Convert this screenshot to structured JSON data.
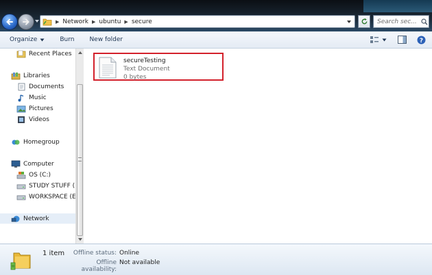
{
  "address": {
    "breadcrumbs": [
      "Network",
      "ubuntu",
      "secure"
    ]
  },
  "search": {
    "placeholder": "Search sec..."
  },
  "toolbar": {
    "organize_label": "Organize",
    "burn_label": "Burn",
    "new_folder_label": "New folder"
  },
  "nav": {
    "items": [
      {
        "label": "Recent Places"
      },
      {
        "label": "Libraries"
      },
      {
        "label": "Documents"
      },
      {
        "label": "Music"
      },
      {
        "label": "Pictures"
      },
      {
        "label": "Videos"
      },
      {
        "label": "Homegroup"
      },
      {
        "label": "Computer"
      },
      {
        "label": "OS (C:)"
      },
      {
        "label": "STUDY STUFF (D:"
      },
      {
        "label": "WORKSPACE (E:)"
      },
      {
        "label": "Network"
      }
    ]
  },
  "files": [
    {
      "name": "secureTesting",
      "type": "Text Document",
      "size": "0 bytes"
    }
  ],
  "status": {
    "item_count": "1 item",
    "offline_status_label": "Offline status:",
    "offline_status_value": "Online",
    "offline_availability_label": "Offline availability:",
    "offline_availability_value": "Not available"
  },
  "colors": {
    "highlight_border": "#d3202b",
    "selection_bg": "#e5eef8",
    "toolbar_text": "#1e3553"
  },
  "icons": {
    "back": "back-arrow-icon",
    "forward": "forward-arrow-icon",
    "search": "search-icon",
    "refresh": "refresh-icon",
    "help": "help-icon"
  }
}
